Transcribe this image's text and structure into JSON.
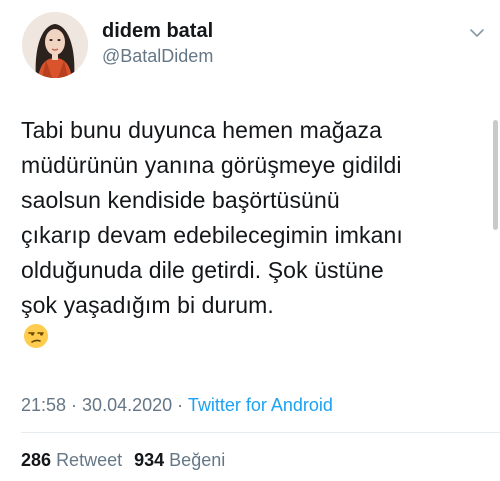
{
  "user": {
    "display_name": "didem batal",
    "handle": "@BatalDidem"
  },
  "tweet": {
    "lines": [
      "Tabi bunu duyunca hemen mağaza",
      "müdürünün yanına görüşmeye gidildi",
      "saolsun kendiside başörtüsünü",
      "çıkarıp devam edebilecegimin imkanı",
      "olduğunuda dile getirdi.  Şok üstüne",
      "şok yaşadığım bi durum."
    ],
    "emoji": "unamused-face-icon"
  },
  "meta": {
    "time": "21:58",
    "separator1": " · ",
    "date": "30.04.2020",
    "separator2": " · ",
    "source": "Twitter for Android"
  },
  "stats": {
    "retweet_count": "286",
    "retweet_label": "Retweet",
    "like_count": "934",
    "like_label": "Beğeni"
  },
  "colors": {
    "text": "#14171a",
    "secondary": "#657786",
    "link": "#1da1f2"
  }
}
